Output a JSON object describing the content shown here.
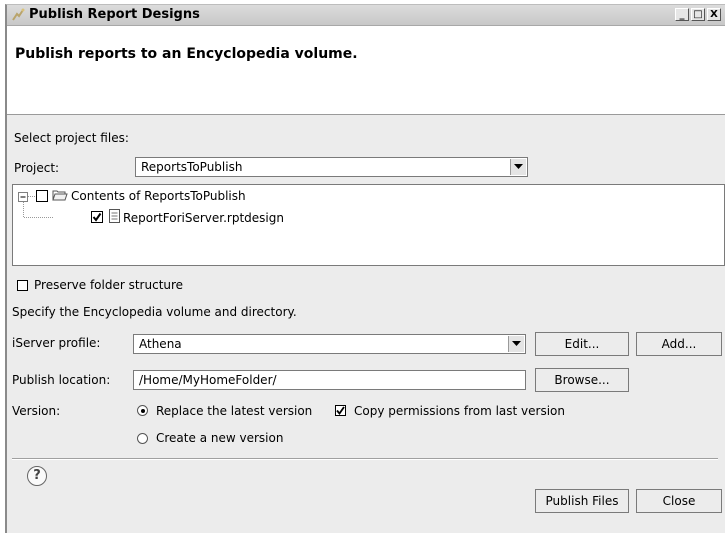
{
  "window": {
    "title": "Publish Report Designs",
    "buttons": [
      "_",
      "□",
      "X"
    ]
  },
  "banner": {
    "title": "Publish reports to an Encyclopedia volume."
  },
  "project_section": {
    "heading": "Select project files:",
    "project_label": "Project:",
    "project_value": "ReportsToPublish"
  },
  "tree": {
    "root": {
      "label": "Contents of ReportsToPublish",
      "checked": false,
      "expanded": true,
      "icon": "folder-open-icon"
    },
    "children": [
      {
        "label": "ReportForiServer.rptdesign",
        "checked": true,
        "icon": "report-design-icon"
      }
    ]
  },
  "options": {
    "preserve_folder_structure": "Preserve folder structure",
    "preserve_checked": false
  },
  "volume_section": {
    "heading": "Specify the Encyclopedia volume and directory.",
    "profile_label": "iServer profile:",
    "profile_value": "Athena",
    "edit_button": "Edit...",
    "add_button": "Add...",
    "location_label": "Publish location:",
    "location_value": "/Home/MyHomeFolder/",
    "browse_button": "Browse..."
  },
  "version_section": {
    "label": "Version:",
    "replace_latest": "Replace the latest version",
    "replace_selected": true,
    "copy_permissions": "Copy permissions from last version",
    "copy_checked": true,
    "create_new": "Create a new version"
  },
  "footer": {
    "help_symbol": "?",
    "publish_button": "Publish Files",
    "close_button": "Close"
  }
}
